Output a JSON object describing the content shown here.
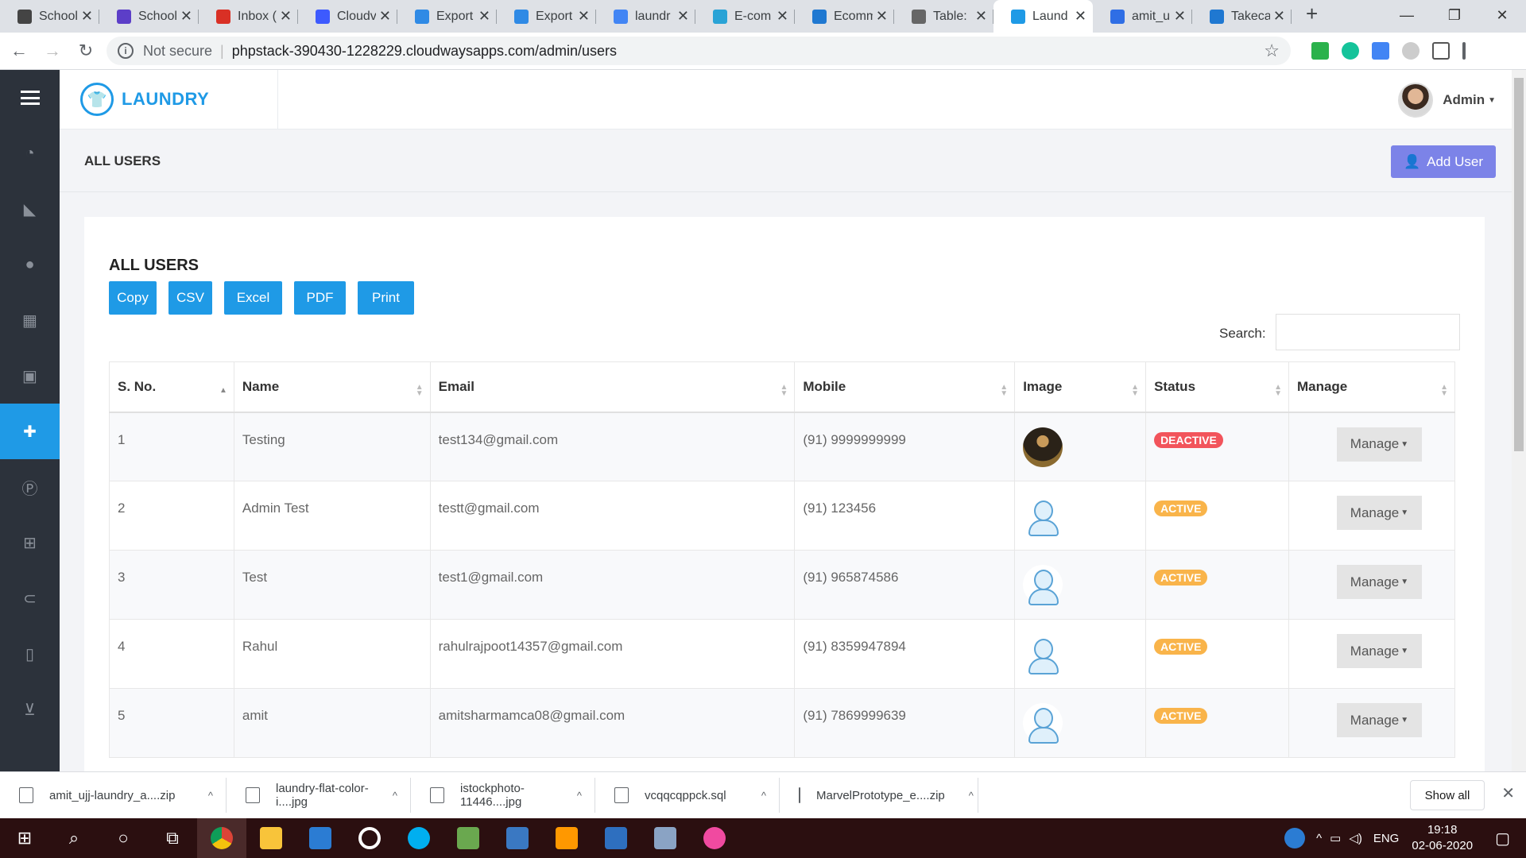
{
  "browser": {
    "tabs": [
      {
        "title": "School",
        "color": "#444"
      },
      {
        "title": "School",
        "color": "#5c3ec8"
      },
      {
        "title": "Inbox (",
        "color": "#d93025"
      },
      {
        "title": "Cloudv",
        "color": "#3d5afe"
      },
      {
        "title": "Export",
        "color": "#2f8ae5"
      },
      {
        "title": "Export",
        "color": "#2f8ae5"
      },
      {
        "title": "laundr",
        "color": "#4285f4"
      },
      {
        "title": "E-com",
        "color": "#29a3d6"
      },
      {
        "title": "Ecomm",
        "color": "#1f78d1"
      },
      {
        "title": "Table: ",
        "color": "#666"
      },
      {
        "title": "Laund",
        "color": "#1f9ae6",
        "active": true
      },
      {
        "title": "amit_u",
        "color": "#2f6ee5"
      },
      {
        "title": "Takeca",
        "color": "#1f78d1"
      }
    ],
    "not_secure": "Not secure",
    "url": "phpstack-390430-1228229.cloudwaysapps.com/admin/users"
  },
  "sidebar": {
    "items": [
      {
        "icon": "dashboard-icon",
        "glyph": "◔"
      },
      {
        "icon": "send-icon",
        "glyph": "◣"
      },
      {
        "icon": "user-icon",
        "glyph": "●"
      },
      {
        "icon": "columns-icon",
        "glyph": "▦"
      },
      {
        "icon": "ad-icon",
        "glyph": "▣"
      },
      {
        "icon": "user-plus-icon",
        "glyph": "✚",
        "active": true
      },
      {
        "icon": "parking-icon",
        "glyph": "Ⓟ"
      },
      {
        "icon": "gift-icon",
        "glyph": "⊞"
      },
      {
        "icon": "comment-icon",
        "glyph": "⊂"
      },
      {
        "icon": "mobile-icon",
        "glyph": "▯"
      },
      {
        "icon": "cart-icon",
        "glyph": "⊻"
      }
    ]
  },
  "header": {
    "logo_text": "LAUNDRY",
    "user_name": "Admin"
  },
  "page": {
    "title": "ALL USERS",
    "add_user": "Add User"
  },
  "card": {
    "title": "ALL USERS",
    "export_buttons": [
      "Copy",
      "CSV",
      "Excel",
      "PDF",
      "Print"
    ],
    "search_label": "Search:",
    "search_value": ""
  },
  "table": {
    "columns": [
      "S. No.",
      "Name",
      "Email",
      "Mobile",
      "Image",
      "Status",
      "Manage"
    ],
    "manage_label": "Manage",
    "rows": [
      {
        "sno": "1",
        "name": "Testing",
        "email": "test134@gmail.com",
        "mobile": "(91) 9999999999",
        "image": "photo",
        "status": "DEACTIVE"
      },
      {
        "sno": "2",
        "name": "Admin Test",
        "email": "testt@gmail.com",
        "mobile": "(91) 123456",
        "image": "default",
        "status": "ACTIVE"
      },
      {
        "sno": "3",
        "name": "Test",
        "email": "test1@gmail.com",
        "mobile": "(91) 965874586",
        "image": "default",
        "status": "ACTIVE"
      },
      {
        "sno": "4",
        "name": "Rahul",
        "email": "rahulrajpoot14357@gmail.com",
        "mobile": "(91) 8359947894",
        "image": "default",
        "status": "ACTIVE"
      },
      {
        "sno": "5",
        "name": "amit",
        "email": "amitsharmamca08@gmail.com",
        "mobile": "(91) 7869999639",
        "image": "default",
        "status": "ACTIVE"
      }
    ]
  },
  "downloads": {
    "items": [
      "amit_ujj-laundry_a....zip",
      "laundry-flat-color-i....jpg",
      "istockphoto-11446....jpg",
      "vcqqcqppck.sql",
      "MarvelPrototype_e....zip"
    ],
    "show_all": "Show all"
  },
  "taskbar": {
    "lang": "ENG",
    "time": "19:18",
    "date": "02-06-2020"
  }
}
